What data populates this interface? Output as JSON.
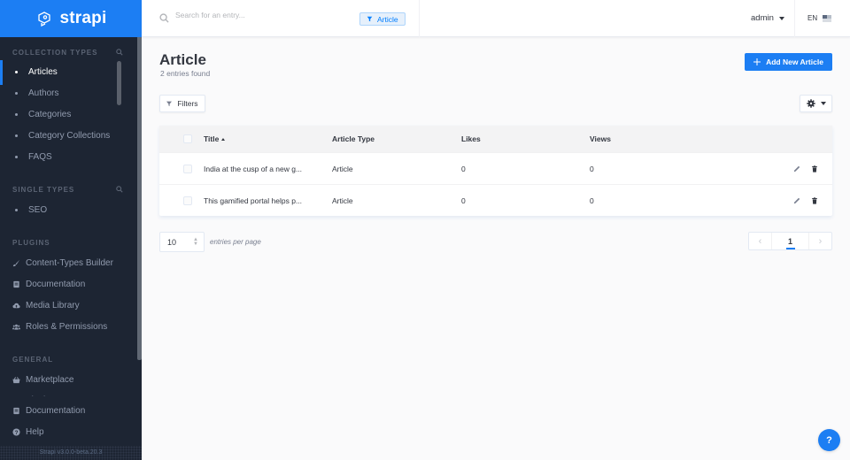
{
  "app": {
    "brand": "strapi",
    "version": "Strapi v3.0.0-beta.20.3"
  },
  "colors": {
    "accent": "#1c7ef3",
    "sidebar_bg": "#1d2533",
    "sidebar_text": "#919bae"
  },
  "header": {
    "search_placeholder": "Search for an entry...",
    "search_filter_tag": "Article",
    "user": "admin",
    "language": "EN"
  },
  "sidebar": {
    "collection_types": {
      "title": "Collection Types",
      "items": [
        {
          "label": "Articles",
          "active": true
        },
        {
          "label": "Authors"
        },
        {
          "label": "Categories"
        },
        {
          "label": "Category Collections"
        },
        {
          "label": "FAQS"
        }
      ]
    },
    "single_types": {
      "title": "Single Types",
      "items": [
        {
          "label": "SEO"
        }
      ]
    },
    "plugins": {
      "title": "Plugins",
      "items": [
        {
          "label": "Content-Types Builder",
          "icon": "paint-brush-icon"
        },
        {
          "label": "Documentation",
          "icon": "book-icon"
        },
        {
          "label": "Media Library",
          "icon": "cloud-upload-icon"
        },
        {
          "label": "Roles & Permissions",
          "icon": "users-icon"
        }
      ]
    },
    "general": {
      "title": "General",
      "items": [
        {
          "label": "Marketplace",
          "icon": "shopping-basket-icon"
        },
        {
          "label": "Plugins",
          "icon": "list-icon"
        }
      ]
    },
    "footer": [
      {
        "label": "Documentation",
        "icon": "book-icon"
      },
      {
        "label": "Help",
        "icon": "question-circle-icon"
      }
    ]
  },
  "main": {
    "title": "Article",
    "subtitle": "2 entries found",
    "add_button": "Add New Article",
    "filters_button": "Filters",
    "table": {
      "columns": [
        "Title",
        "Article Type",
        "Likes",
        "Views"
      ],
      "sorted_column": "Title",
      "sort_direction": "asc",
      "rows": [
        {
          "title": "India at the cusp of a new g...",
          "article_type": "Article",
          "likes": "0",
          "views": "0"
        },
        {
          "title": "This gamified portal helps p...",
          "article_type": "Article",
          "likes": "0",
          "views": "0"
        }
      ]
    },
    "pagination": {
      "per_page": "10",
      "per_page_label": "entries per page",
      "current_page": "1",
      "prev": "‹",
      "next": "›"
    },
    "help_button": "?"
  }
}
